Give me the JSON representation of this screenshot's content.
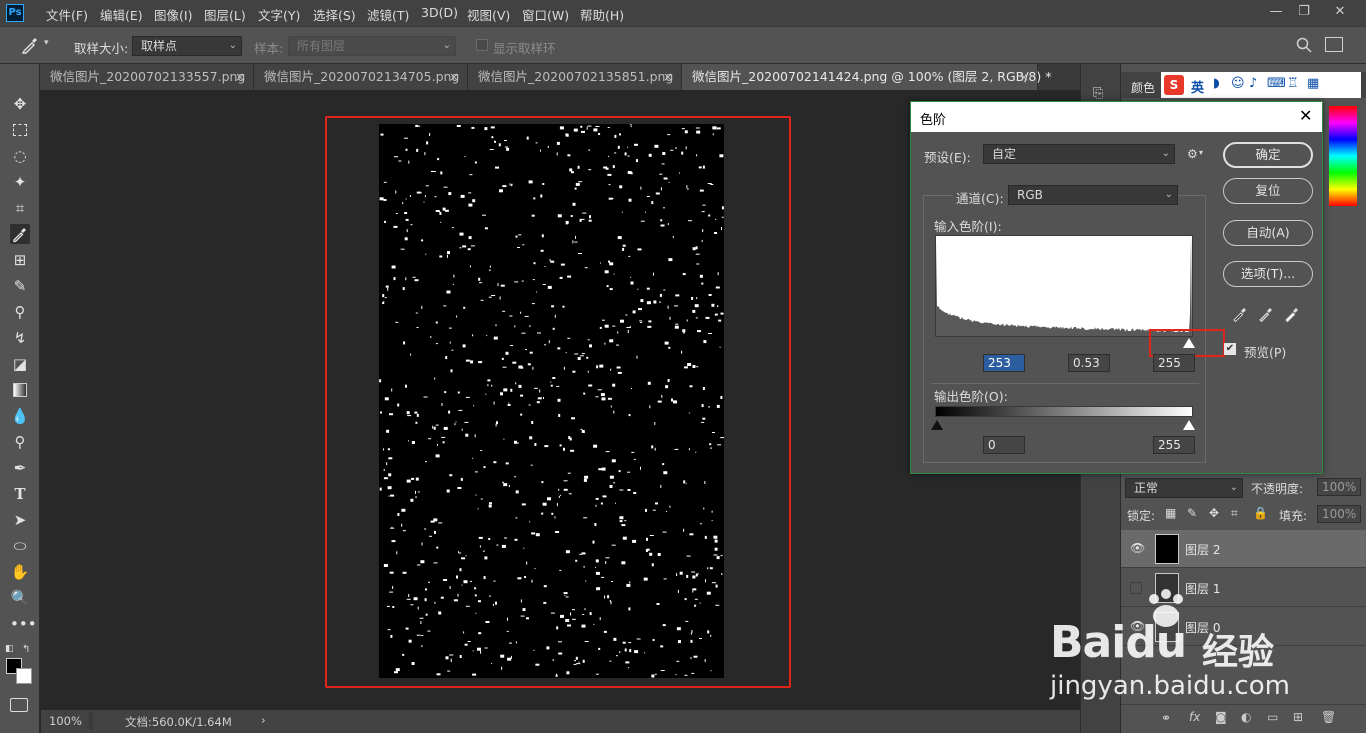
{
  "app": {
    "logo": "Ps"
  },
  "menu": [
    "文件(F)",
    "编辑(E)",
    "图像(I)",
    "图层(L)",
    "文字(Y)",
    "选择(S)",
    "滤镜(T)",
    "3D(D)",
    "视图(V)",
    "窗口(W)",
    "帮助(H)"
  ],
  "options": {
    "sample_size_label": "取样大小:",
    "sample_size_value": "取样点",
    "sample_label": "样本:",
    "sample_value": "所有图层",
    "show_ring_label": "显示取样环"
  },
  "tabs": [
    {
      "label": "微信图片_20200702133557.png"
    },
    {
      "label": "微信图片_20200702134705.png"
    },
    {
      "label": "微信图片_20200702135851.png"
    },
    {
      "label": "微信图片_20200702141424.png @ 100% (图层 2, RGB/8) *"
    }
  ],
  "status": {
    "zoom": "100%",
    "doc": "文档:560.0K/1.64M"
  },
  "levels_dialog": {
    "title": "色阶",
    "preset_label": "预设(E):",
    "preset_value": "自定",
    "channel_label": "通道(C):",
    "channel_value": "RGB",
    "input_label": "输入色阶(I):",
    "input_black": "253",
    "input_gamma": "0.53",
    "input_white": "255",
    "output_label": "输出色阶(O):",
    "output_black": "0",
    "output_white": "255",
    "buttons": {
      "ok": "确定",
      "reset": "复位",
      "auto": "自动(A)",
      "options": "选项(T)..."
    },
    "preview_label": "预览(P)",
    "preview_checked": true
  },
  "right_panel": {
    "color_tab": "颜色",
    "ime_label": "英",
    "blend_mode": "正常",
    "opacity_label": "不透明度:",
    "opacity_value": "100%",
    "lock_label": "锁定:",
    "fill_label": "填充:",
    "fill_value": "100%",
    "layers": [
      {
        "name": "图层 2",
        "visible": true,
        "selected": true
      },
      {
        "name": "图层 1",
        "visible": false,
        "selected": false
      },
      {
        "name": "图层 0",
        "visible": true,
        "selected": false
      }
    ]
  },
  "watermark": {
    "brand": "Bai",
    "brand2": "du",
    "cn": "经验",
    "url": "jingyan.baidu.com"
  },
  "colors": {
    "accent": "#31a8ff",
    "highlight_red": "#e0251b"
  }
}
